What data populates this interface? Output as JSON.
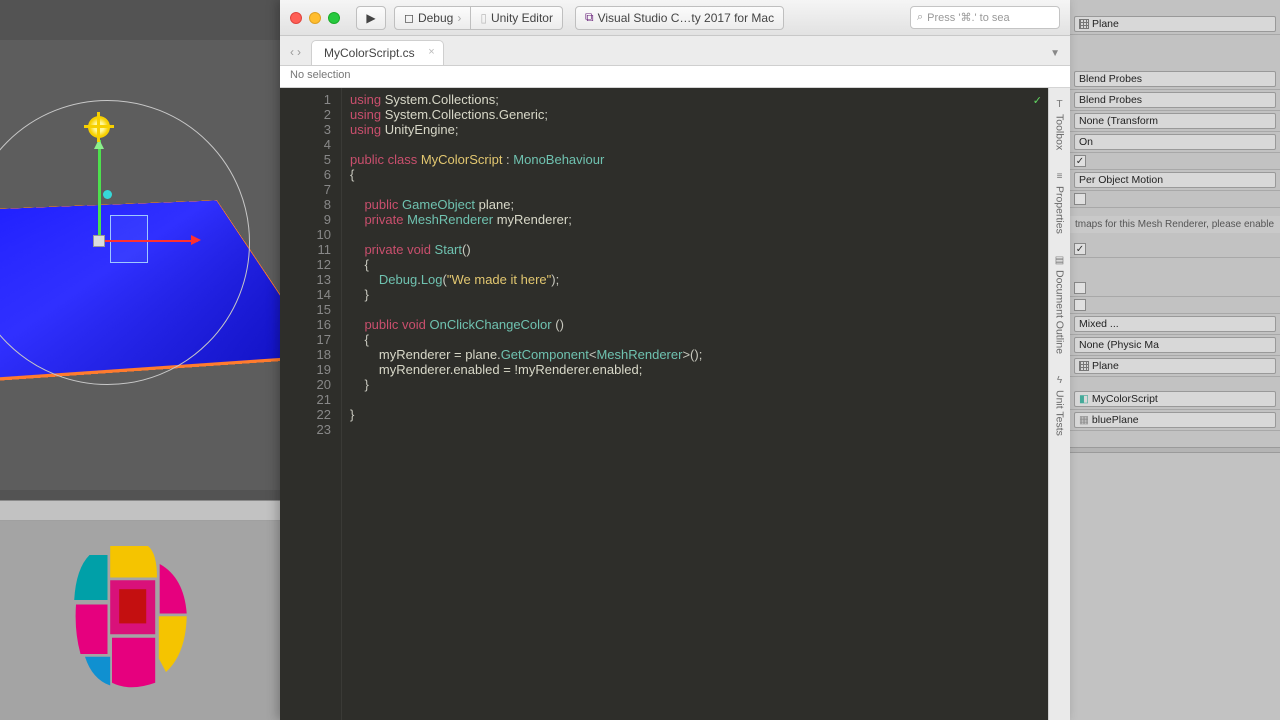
{
  "unity": {
    "inspector": {
      "plane_field": "Plane",
      "blend1": "Blend Probes",
      "blend2": "Blend Probes",
      "anchor": "None (Transform",
      "on": "On",
      "motion": "Per Object Motion",
      "msg": "tmaps for this Mesh Renderer, please enable",
      "mixed": "Mixed ...",
      "physmat": "None (Physic Ma",
      "plane2": "Plane",
      "script": "MyColorScript",
      "blueplane": "bluePlane"
    }
  },
  "vs": {
    "toolbar": {
      "debug": "Debug",
      "target": "Unity Editor",
      "app": "Visual Studio C…ty 2017 for Mac",
      "search_ph": "Press '⌘.' to sea"
    },
    "tab": "MyColorScript.cs",
    "breadcrumb": "No selection",
    "side": {
      "toolbox": "Toolbox",
      "props": "Properties",
      "outline": "Document Outline",
      "tests": "Unit Tests"
    },
    "lines": [
      "1",
      "2",
      "3",
      "4",
      "5",
      "6",
      "7",
      "8",
      "9",
      "10",
      "11",
      "12",
      "13",
      "14",
      "15",
      "16",
      "17",
      "18",
      "19",
      "20",
      "21",
      "22",
      "23"
    ],
    "code": {
      "l1a": "using ",
      "l1b": "System.Collections",
      "l1c": ";",
      "l2a": "using ",
      "l2b": "System.Collections.Generic",
      "l2c": ";",
      "l3a": "using ",
      "l3b": "UnityEngine",
      "l3c": ";",
      "l5a": "public class ",
      "l5b": "MyColorScript",
      "l5c": " : ",
      "l5d": "MonoBehaviour",
      "l6": "{",
      "l8a": "    public ",
      "l8b": "GameObject",
      "l8c": " plane",
      "l9a": "    private ",
      "l9b": "MeshRenderer",
      "l9c": " myRenderer",
      "l11a": "    private void ",
      "l11b": "Start",
      "l11c": "()",
      "l12": "    {",
      "l13a": "        Debug",
      "l13b": ".",
      "l13c": "Log",
      "l13d": "(",
      "l13e": "\"We made it here\"",
      "l13f": ");",
      "l14": "    }",
      "l16a": "    public void ",
      "l16b": "OnClickChangeColor",
      "l16c": " ()",
      "l17": "    {",
      "l18a": "        myRenderer = ",
      "l18b": "plane",
      "l18c": ".",
      "l18d": "GetComponent",
      "l18e": "<",
      "l18f": "MeshRenderer",
      "l18g": ">();",
      "l19": "        myRenderer.enabled = !myRenderer.enabled;",
      "l20": "    }",
      "l22": "}"
    }
  }
}
